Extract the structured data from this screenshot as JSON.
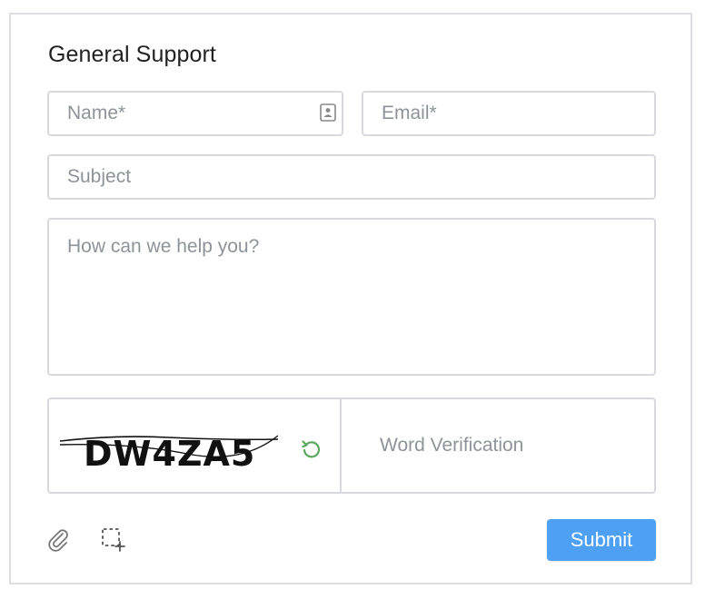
{
  "form": {
    "title": "General Support",
    "name_placeholder": "Name*",
    "email_placeholder": "Email*",
    "subject_placeholder": "Subject",
    "message_placeholder": "How can we help you?",
    "captcha_code": "DW4ZA5",
    "verification_placeholder": "Word Verification",
    "submit_label": "Submit"
  },
  "icons": {
    "contact": "contact-card-icon",
    "refresh": "refresh-icon",
    "attach": "paperclip-icon",
    "screenshot": "screenshot-icon"
  },
  "colors": {
    "accent": "#4ea0f4",
    "refresh": "#5aa85c",
    "border": "#d7d9de"
  }
}
